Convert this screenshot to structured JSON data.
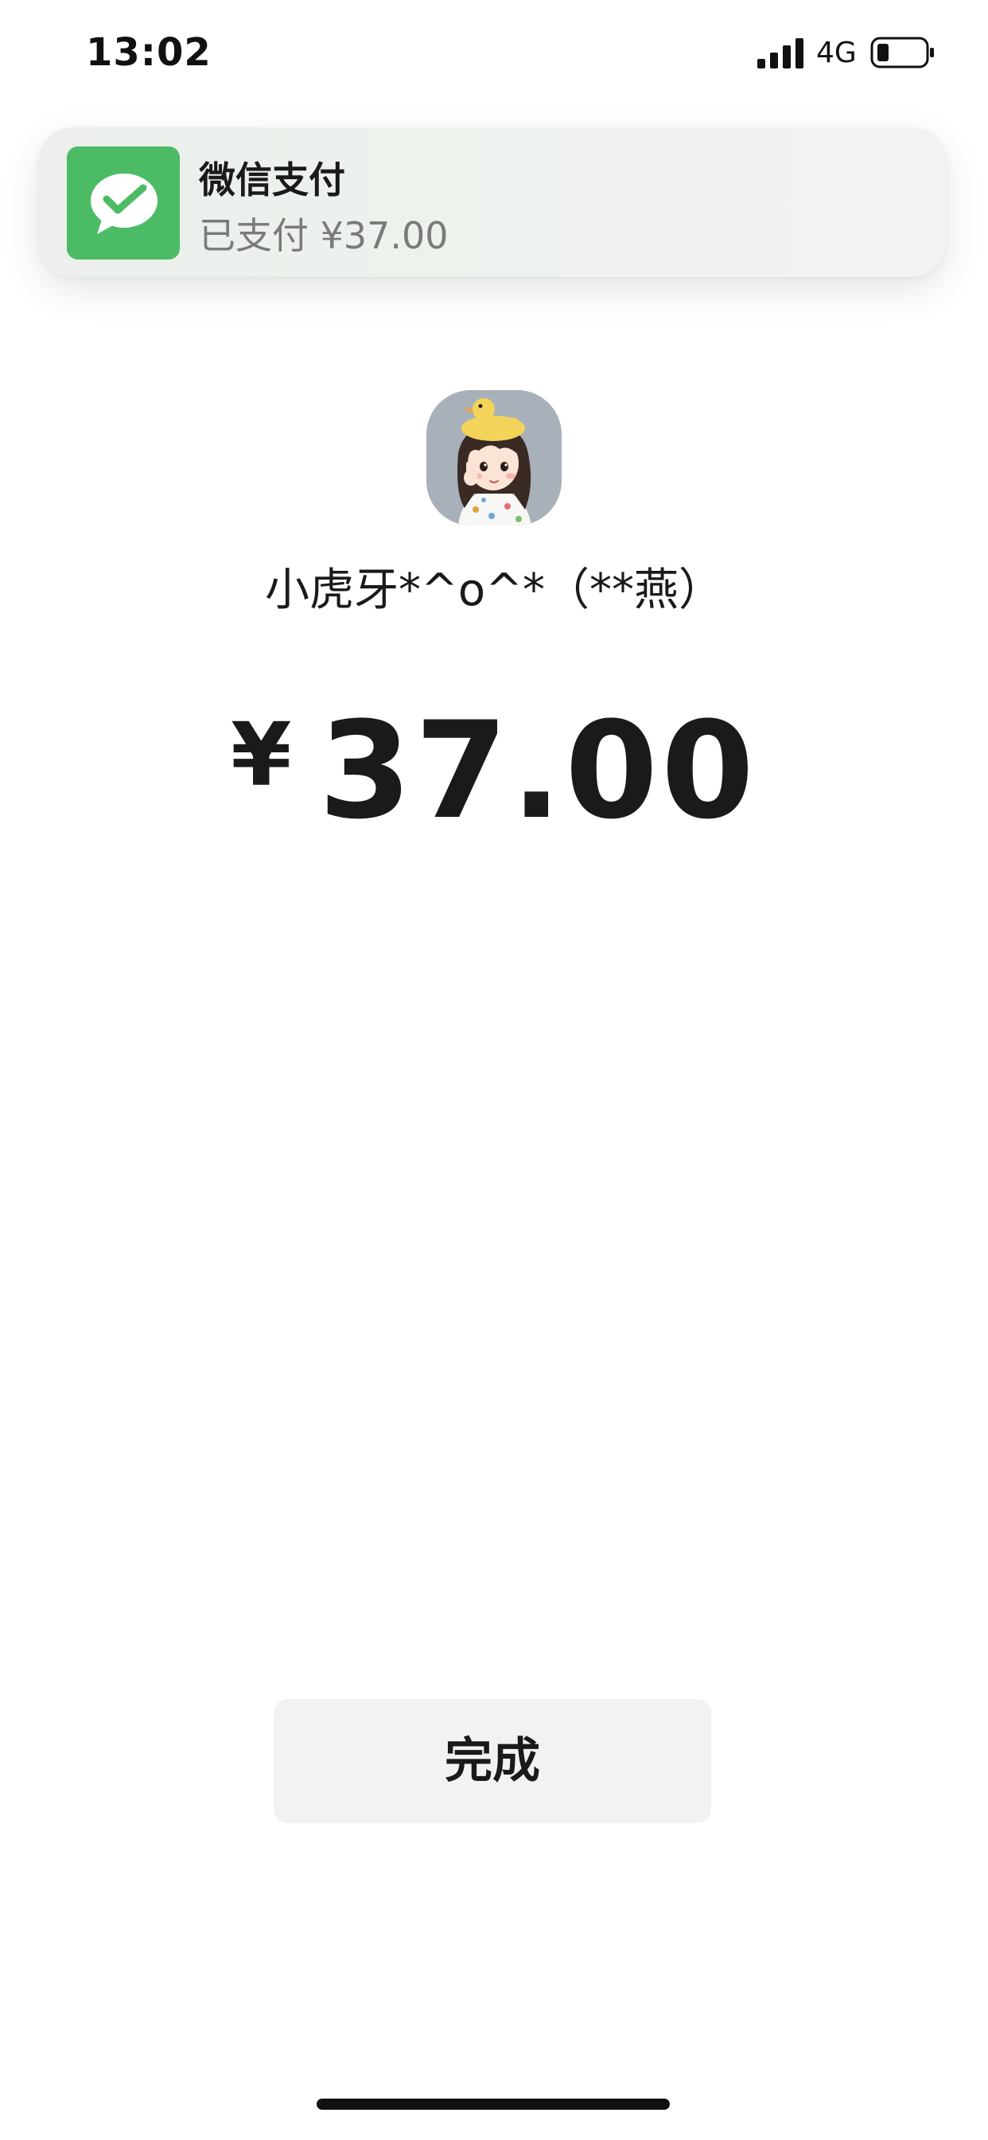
{
  "status_bar": {
    "time": "13:02",
    "network": "4G",
    "icons": [
      "signal-bars-icon",
      "battery-icon"
    ]
  },
  "notification": {
    "app_icon": "wechat-pay-icon",
    "app_icon_color": "#4cbb66",
    "title": "微信支付",
    "body": "已支付 ¥37.00"
  },
  "payee": {
    "avatar": "avatar-image",
    "name": "小虎牙*^o^*（**燕）"
  },
  "payment": {
    "currency_symbol": "¥",
    "amount": "37.00"
  },
  "actions": {
    "done_label": "完成"
  },
  "colors": {
    "accent_green": "#4cbb66",
    "button_bg": "#f2f2f2",
    "text_primary": "#1a1a1a",
    "text_secondary": "#7a7a7a"
  }
}
